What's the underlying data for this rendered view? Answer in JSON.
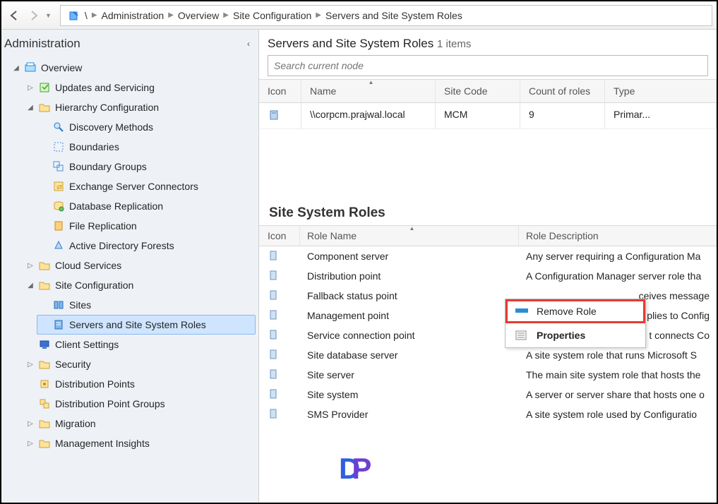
{
  "nav": {
    "back_enabled": true,
    "fwd_enabled": false,
    "crumbs": [
      "\\",
      "Administration",
      "Overview",
      "Site Configuration",
      "Servers and Site System Roles"
    ]
  },
  "left": {
    "title": "Administration",
    "tree": {
      "overview": "Overview",
      "updates": "Updates and Servicing",
      "hier": "Hierarchy Configuration",
      "discovery": "Discovery Methods",
      "boundaries": "Boundaries",
      "bgroups": "Boundary Groups",
      "exch": "Exchange Server Connectors",
      "dbrep": "Database Replication",
      "filerep": "File Replication",
      "adf": "Active Directory Forests",
      "cloud": "Cloud Services",
      "siteconf": "Site Configuration",
      "sites": "Sites",
      "servers": "Servers and Site System Roles",
      "client": "Client Settings",
      "security": "Security",
      "dp": "Distribution Points",
      "dpg": "Distribution Point Groups",
      "migration": "Migration",
      "mgmt": "Management Insights"
    }
  },
  "header": {
    "title": "Servers and Site System Roles",
    "count": "1 items",
    "search_placeholder": "Search current node"
  },
  "grid": {
    "cols": {
      "icon": "Icon",
      "name": "Name",
      "site": "Site Code",
      "count": "Count of roles",
      "type": "Type"
    },
    "row": {
      "name": "\\\\corpcm.prajwal.local",
      "site": "MCM",
      "count": "9",
      "type": "Primar..."
    }
  },
  "roles": {
    "title": "Site System Roles",
    "cols": {
      "icon": "Icon",
      "role": "Role Name",
      "desc": "Role Description"
    },
    "items": [
      {
        "name": "Component server",
        "desc": "Any server requiring a Configuration Ma"
      },
      {
        "name": "Distribution point",
        "desc": "A Configuration Manager server role tha"
      },
      {
        "name": "Fallback status point",
        "desc": "ceives message"
      },
      {
        "name": "Management point",
        "desc": "plies to Config"
      },
      {
        "name": "Service connection point",
        "desc": "t connects Co"
      },
      {
        "name": "Site database server",
        "desc": "A site system role that runs Microsoft S"
      },
      {
        "name": "Site server",
        "desc": "The main site system role that hosts the"
      },
      {
        "name": "Site system",
        "desc": "A server or server share that hosts one o"
      },
      {
        "name": "SMS Provider",
        "desc": "A site system role used by Configuratio"
      }
    ]
  },
  "ctx": {
    "remove": "Remove Role",
    "props": "Properties"
  }
}
